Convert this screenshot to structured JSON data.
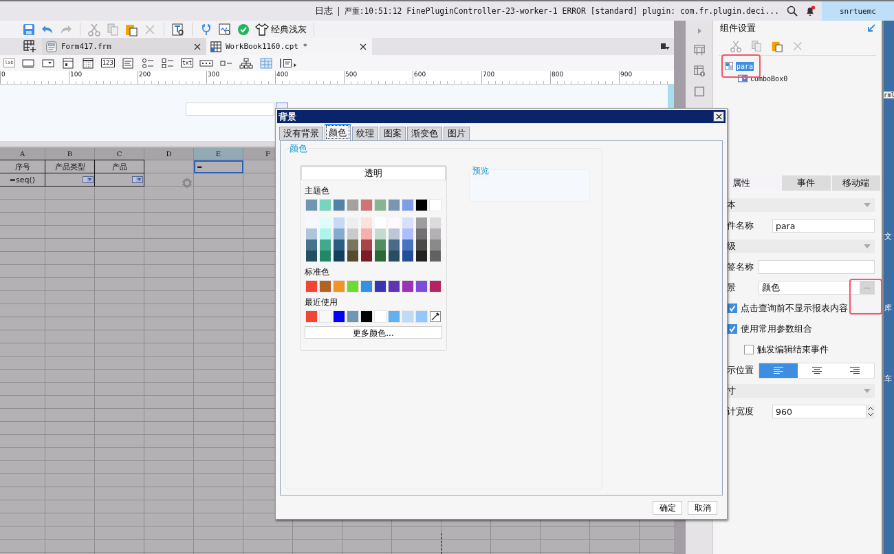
{
  "status_bar": {
    "log_label": "日志",
    "log_message": "严重:10:51:12 FinePluginController-23-worker-1 ERROR [standard] plugin: com.fr.plugin.deci...",
    "notification": true,
    "user": "snrtuemc"
  },
  "toolbar": {
    "theme_label": "经典浅灰"
  },
  "file_tabs": [
    {
      "label": "Form417.frm",
      "kind": "form",
      "selected": false
    },
    {
      "label": "WorkBook1160.cpt *",
      "kind": "workbook",
      "selected": true
    }
  ],
  "widget_palette": [
    {
      "kind": "label",
      "text": "lab"
    },
    {
      "kind": "textbox"
    },
    {
      "kind": "dropdown"
    },
    {
      "kind": "panel"
    },
    {
      "kind": "calendar"
    },
    {
      "kind": "number",
      "text": "123"
    },
    {
      "kind": "textarea"
    },
    {
      "kind": "radio"
    },
    {
      "kind": "checkgroup"
    },
    {
      "kind": "text",
      "text": "txt"
    },
    {
      "kind": "password"
    },
    {
      "kind": "checkbox"
    },
    {
      "kind": "tree"
    },
    {
      "kind": "table"
    },
    {
      "kind": "more"
    }
  ],
  "ruler": [
    "0",
    "100",
    "200",
    "300",
    "400",
    "500",
    "600",
    "700",
    "800",
    "900"
  ],
  "sheet": {
    "columns": [
      "A",
      "B",
      "C",
      "D",
      "E",
      "F"
    ],
    "rows": [
      [
        {
          "kind": "text",
          "text": "序号",
          "bordered": true,
          "selected": false
        },
        {
          "kind": "text",
          "text": "产品类型",
          "bordered": true,
          "selected": false
        },
        {
          "kind": "text",
          "text": "产品",
          "bordered": true,
          "selected": false
        },
        {
          "kind": "empty"
        },
        {
          "kind": "text",
          "text": "=",
          "bordered": false,
          "selected": true
        }
      ],
      [
        {
          "kind": "text",
          "text": "=seq()",
          "bordered": true,
          "selected": false
        },
        {
          "kind": "combo",
          "bordered": true,
          "selected": false
        },
        {
          "kind": "combo",
          "bordered": true,
          "selected": false
        },
        {
          "kind": "gear"
        }
      ]
    ]
  },
  "component_settings": {
    "title": "组件设置",
    "tree": [
      {
        "label": "para",
        "selected": true,
        "children": [
          {
            "label": "comboBox0",
            "selected": false
          }
        ]
      }
    ]
  },
  "property_tabs": [
    {
      "label": "属性",
      "selected": true
    },
    {
      "label": "事件",
      "selected": false
    },
    {
      "label": "移动端",
      "selected": false
    }
  ],
  "properties": [
    {
      "kind": "section",
      "label": "本"
    },
    {
      "kind": "field",
      "label": "件名称",
      "value": "para"
    },
    {
      "kind": "section",
      "label": "级"
    },
    {
      "kind": "field",
      "label": "签名称"
    },
    {
      "kind": "picker",
      "label": "景",
      "value": "颜色",
      "button": "···"
    },
    {
      "kind": "checkbox",
      "label": "点击查询前不显示报表内容",
      "checked": true
    },
    {
      "kind": "checkbox",
      "label": "使用常用参数组合",
      "checked": true
    },
    {
      "kind": "subcheckbox",
      "label": "触发编辑结束事件",
      "checked": false
    },
    {
      "kind": "align",
      "label": "示位置",
      "options": [
        {
          "kind": "left",
          "selected": true
        },
        {
          "kind": "center",
          "selected": false
        },
        {
          "kind": "right",
          "selected": false
        }
      ]
    },
    {
      "kind": "section",
      "label": "寸"
    },
    {
      "kind": "spinner",
      "label": "计宽度",
      "value": "960"
    }
  ],
  "desktop_edge": [
    "rml",
    "文",
    "库",
    "车"
  ],
  "dialog": {
    "title": "背景",
    "tabs": [
      {
        "label": "没有背景",
        "selected": false
      },
      {
        "label": "颜色",
        "selected": true
      },
      {
        "label": "纹理",
        "selected": false
      },
      {
        "label": "图案",
        "selected": false
      },
      {
        "label": "渐变色",
        "selected": false
      },
      {
        "label": "图片",
        "selected": false
      }
    ],
    "group_label": "颜色",
    "transparent_button": "透明",
    "theme_label": "主题色",
    "theme_colors": [
      {
        "color": "#7097b2"
      },
      {
        "color": "#76d4bf"
      },
      {
        "color": "#5282a8"
      },
      {
        "color": "#a5a29b"
      },
      {
        "color": "#d07573"
      },
      {
        "color": "#85b593"
      },
      {
        "color": "#7b96ae"
      },
      {
        "color": "#7f9ce6"
      },
      {
        "color": "#000000"
      },
      {
        "color": "#ffffff"
      }
    ],
    "shade_colors": [
      {
        "color": "#f5f9fd"
      },
      {
        "color": "#dcfefc"
      },
      {
        "color": "#c5d9f5"
      },
      {
        "color": "#eeeeee"
      },
      {
        "color": "#fde1dc"
      },
      {
        "color": "#ffffff"
      },
      {
        "color": "#fdf9fd"
      },
      {
        "color": "#d6e0fd"
      },
      {
        "color": "#9e9c9e"
      },
      {
        "color": "#dcdadc"
      },
      {
        "color": "#adc6dc"
      },
      {
        "color": "#adf5e8"
      },
      {
        "color": "#86aacc"
      },
      {
        "color": "#ccc9cc"
      },
      {
        "color": "#f6b0ab"
      },
      {
        "color": "#c5dace"
      },
      {
        "color": "#bdc6d5"
      },
      {
        "color": "#aebefd"
      },
      {
        "color": "#727072"
      },
      {
        "color": "#b3b1b3"
      },
      {
        "color": "#44738b"
      },
      {
        "color": "#42aa8c"
      },
      {
        "color": "#2b5d82"
      },
      {
        "color": "#7a7360"
      },
      {
        "color": "#a84549"
      },
      {
        "color": "#528e62"
      },
      {
        "color": "#496a8a"
      },
      {
        "color": "#4a72c2"
      },
      {
        "color": "#4a4a48"
      },
      {
        "color": "#8a8b89"
      },
      {
        "color": "#225060"
      },
      {
        "color": "#228868"
      },
      {
        "color": "#133f5c"
      },
      {
        "color": "#554c30"
      },
      {
        "color": "#7c1c27"
      },
      {
        "color": "#2a6934"
      },
      {
        "color": "#2a4c62"
      },
      {
        "color": "#234f96"
      },
      {
        "color": "#222222"
      },
      {
        "color": "#626262"
      }
    ],
    "standard_label": "标准色",
    "standard_colors": [
      {
        "color": "#f04632"
      },
      {
        "color": "#b46124"
      },
      {
        "color": "#f09624"
      },
      {
        "color": "#6cdb32"
      },
      {
        "color": "#3291e0"
      },
      {
        "color": "#3c33b4"
      },
      {
        "color": "#6033b4"
      },
      {
        "color": "#9c33b4"
      },
      {
        "color": "#7c4cdc"
      },
      {
        "color": "#b42462"
      }
    ],
    "recent_label": "最近使用",
    "recent_colors": [
      {
        "color": "#f04632"
      },
      {
        "color": "#f5f9fd"
      },
      {
        "color": "#0000ff"
      },
      {
        "color": "#7097b2"
      },
      {
        "color": "#000000"
      },
      {
        "color": "#ffffff"
      },
      {
        "color": "#62b0f0"
      },
      {
        "color": "#bedaf5"
      },
      {
        "color": "#92c8fc"
      }
    ],
    "more_button": "更多颜色...",
    "preview_label": "预览",
    "buttons": [
      "确定",
      "取消"
    ]
  }
}
